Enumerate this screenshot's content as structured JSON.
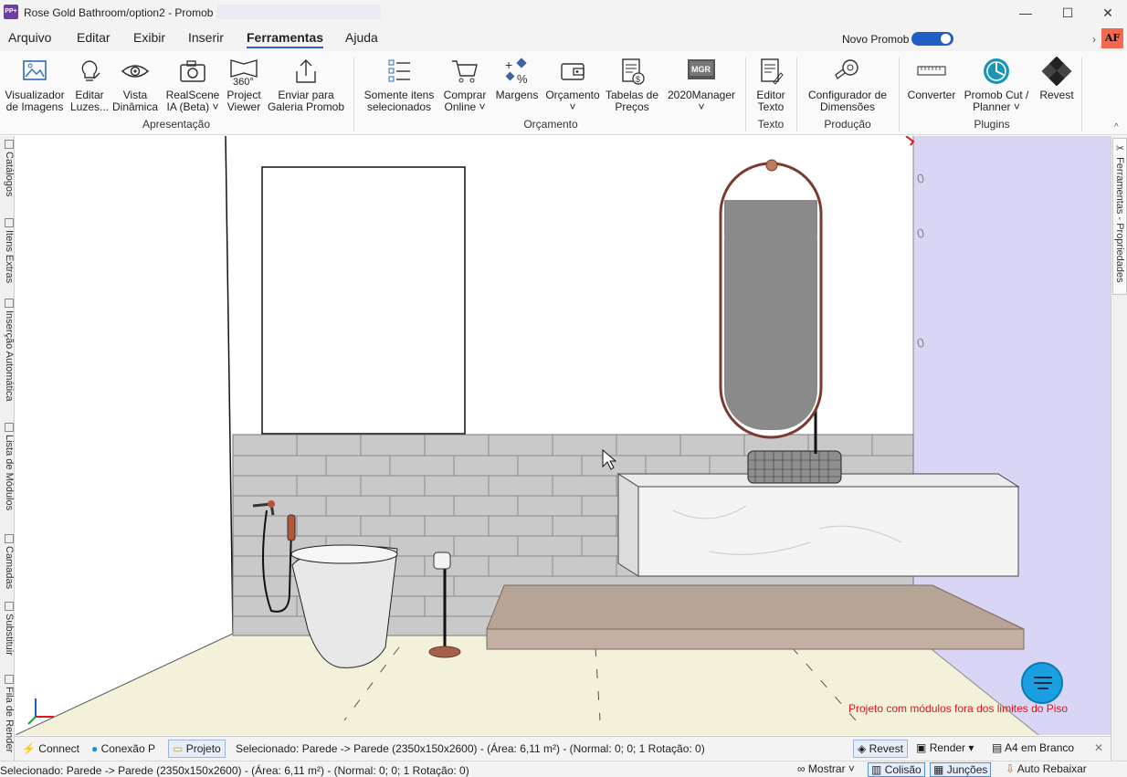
{
  "window": {
    "title": "Rose Gold Bathroom/option2 - Promob",
    "logo_text": "PP+",
    "controls": {
      "minimize": "—",
      "maximize": "☐",
      "close": "✕"
    }
  },
  "menu": {
    "items": [
      "Arquivo",
      "Editar",
      "Exibir",
      "Inserir",
      "Ferramentas",
      "Ajuda"
    ],
    "active": "Ferramentas",
    "novo_promob_label": "Novo Promob",
    "novo_promob_on": true,
    "avatar_text": "AF",
    "avatar_color": "#f1694f"
  },
  "ribbon": {
    "groups": [
      {
        "label": "Apresentação",
        "buttons": [
          {
            "l1": "Visualizador",
            "l2": "de Imagens",
            "icon": "image-icon"
          },
          {
            "l1": "Editar",
            "l2": "Luzes...",
            "icon": "lightbulb-icon"
          },
          {
            "l1": "Vista",
            "l2": "Dinâmica",
            "icon": "eye-icon"
          },
          {
            "l1": "RealScene",
            "l2": "IA (Beta) ˅",
            "icon": "camera-icon"
          },
          {
            "l1": "Project",
            "l2": "Viewer",
            "icon": "360-icon"
          },
          {
            "l1": "Enviar para",
            "l2": "Galeria Promob",
            "icon": "upload-icon"
          }
        ]
      },
      {
        "label": "Orçamento",
        "buttons": [
          {
            "l1": "Somente itens",
            "l2": "selecionados",
            "icon": "checklist-icon"
          },
          {
            "l1": "Comprar",
            "l2": "Online ˅",
            "icon": "cart-icon"
          },
          {
            "l1": "Margens",
            "l2": "",
            "icon": "margins-icon"
          },
          {
            "l1": "Orçamento",
            "l2": "˅",
            "icon": "wallet-icon"
          },
          {
            "l1": "Tabelas de",
            "l2": "Preços",
            "icon": "price-table-icon"
          },
          {
            "l1": "2020Manager",
            "l2": "˅",
            "icon": "mgr-icon"
          }
        ]
      },
      {
        "label": "Texto",
        "buttons": [
          {
            "l1": "Editor",
            "l2": "Texto",
            "icon": "text-editor-icon"
          }
        ]
      },
      {
        "label": "Produção",
        "buttons": [
          {
            "l1": "Configurador de",
            "l2": "Dimensões",
            "icon": "tape-measure-icon"
          }
        ]
      },
      {
        "label": "Plugins",
        "buttons": [
          {
            "l1": "Converter",
            "l2": "",
            "icon": "ruler-icon"
          },
          {
            "l1": "Promob Cut /",
            "l2": "Planner ˅",
            "icon": "cut-planner-icon"
          },
          {
            "l1": "Revest",
            "l2": "",
            "icon": "revest-icon"
          }
        ]
      }
    ]
  },
  "left_tabs": [
    "Catálogos",
    "Itens Extras",
    "Inserção Automática",
    "Lista de Módulos",
    "Camadas",
    "Substituir",
    "Fila de Render"
  ],
  "right_tab": "Ferramentas - Propriedades",
  "viewport": {
    "warning": "Projeto com módulos fora dos limites do Piso"
  },
  "bottom_bar": {
    "connect": "Connect",
    "conexao": "Conexão P",
    "projeto": "Projeto",
    "selection": "Selecionado: Parede -> Parede (2350x150x2600) - (Área: 6,11 m²) - (Normal: 0; 0; 1 Rotação: 0)",
    "revest": "Revest",
    "render": "Render",
    "a4": "A4 em Branco",
    "close": "✕"
  },
  "status_bar": {
    "text": "Selecionado: Parede -> Parede (2350x150x2600) - (Área: 6,11 m²) - (Normal: 0; 0; 1 Rotação: 0)",
    "mostrar": "Mostrar ˅",
    "colisao": "Colisão",
    "juncoes": "Junções",
    "auto_rebaixar": "Auto Rebaixar"
  }
}
